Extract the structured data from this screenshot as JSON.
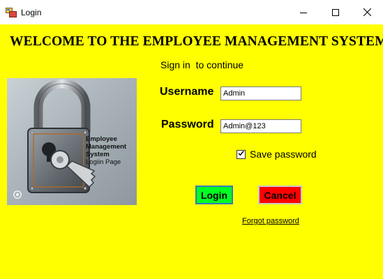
{
  "window": {
    "title": "Login"
  },
  "header": {
    "title": "WELCOME TO THE EMPLOYEE MANAGEMENT SYSTEM",
    "subtitle": "Sign in  to continue"
  },
  "logo": {
    "lines": [
      "Employee",
      "Management",
      "System",
      "Logiin Page"
    ]
  },
  "form": {
    "username_label": "Username",
    "username_value": "Admin",
    "password_label": "Password",
    "password_value": "Admin@123",
    "save_password_label": "Save password",
    "save_password_checked": true
  },
  "buttons": {
    "login": "Login",
    "cancel": "Cancel"
  },
  "links": {
    "forgot_password": "Forgot password"
  },
  "colors": {
    "background": "#ffff00",
    "login_button": "#00ff22",
    "cancel_button": "#ff0000"
  },
  "icons": [
    "app-icon",
    "minimize-icon",
    "maximize-icon",
    "close-icon",
    "padlock-icon",
    "key-icon",
    "checkmark-icon"
  ]
}
